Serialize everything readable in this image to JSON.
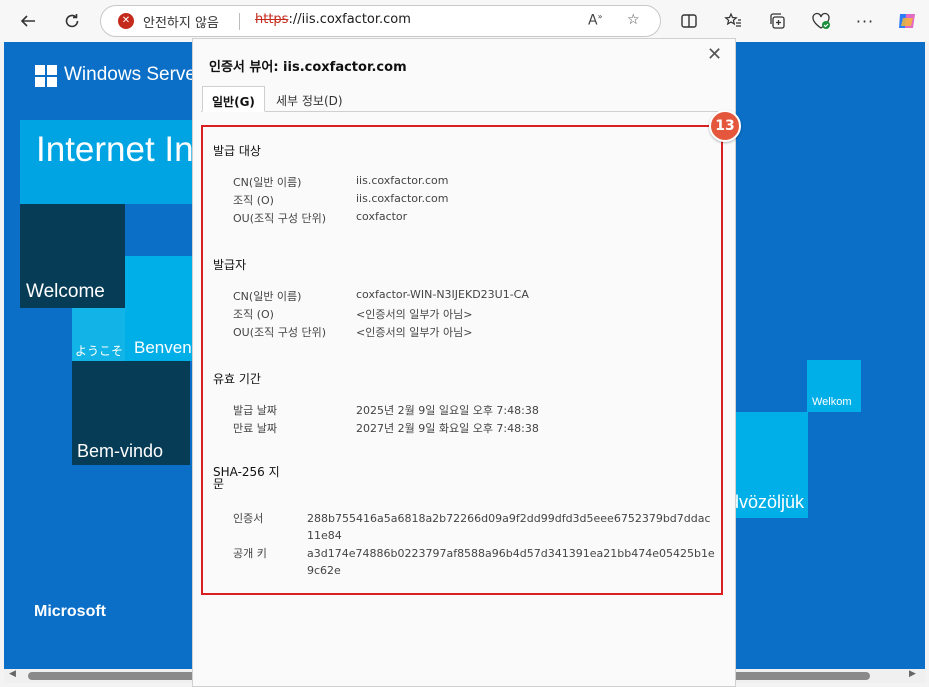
{
  "browser": {
    "security_label": "안전하지 않음",
    "url_scheme": "https",
    "url_rest": "://iis.coxfactor.com"
  },
  "background": {
    "brand": "Windows Server",
    "tiles": {
      "internet": "Internet Information Services",
      "welcome": "Welcome",
      "youkoso": "ようこそ",
      "benvenuto": "Benvenuto",
      "bemvindo": "Bem-vindo",
      "welkom": "Welkom",
      "udvozoljuk": "Üdvözöljük"
    },
    "microsoft": "Microsoft"
  },
  "dialog": {
    "title": "인증서 뷰어: iis.coxfactor.com",
    "close_symbol": "✕",
    "tabs": [
      "일반(G)",
      "세부 정보(D)"
    ],
    "badge": "13",
    "issued_to": {
      "heading": "발급 대상",
      "rows": [
        {
          "label": "CN(일반 이름)",
          "value": "iis.coxfactor.com"
        },
        {
          "label": "조직 (O)",
          "value": "iis.coxfactor.com"
        },
        {
          "label": "OU(조직 구성 단위)",
          "value": "coxfactor"
        }
      ]
    },
    "issued_by": {
      "heading": "발급자",
      "rows": [
        {
          "label": "CN(일반 이름)",
          "value": "coxfactor-WIN-N3IJEKD23U1-CA"
        },
        {
          "label": "조직 (O)",
          "value": "<인증서의 일부가 아님>"
        },
        {
          "label": "OU(조직 구성 단위)",
          "value": "<인증서의 일부가 아님>"
        }
      ]
    },
    "validity": {
      "heading": "유효 기간",
      "rows": [
        {
          "label": "발급 날짜",
          "value": "2025년 2월 9일 일요일 오후 7:48:38"
        },
        {
          "label": "만료 날짜",
          "value": "2027년 2월 9일 화요일 오후 7:48:38"
        }
      ]
    },
    "fingerprints": {
      "heading_line1": "SHA-256 지",
      "heading_line2": "문",
      "rows": [
        {
          "label": "인증서",
          "value": "288b755416a5a6818a2b72266d09a9f2dd99dfd3d5eee6752379bd7ddac11e84"
        },
        {
          "label": "공개 키",
          "value": "a3d174e74886b0223797af8588a96b4d57d341391ea21bb474e05425b1e9c62e"
        }
      ]
    }
  }
}
